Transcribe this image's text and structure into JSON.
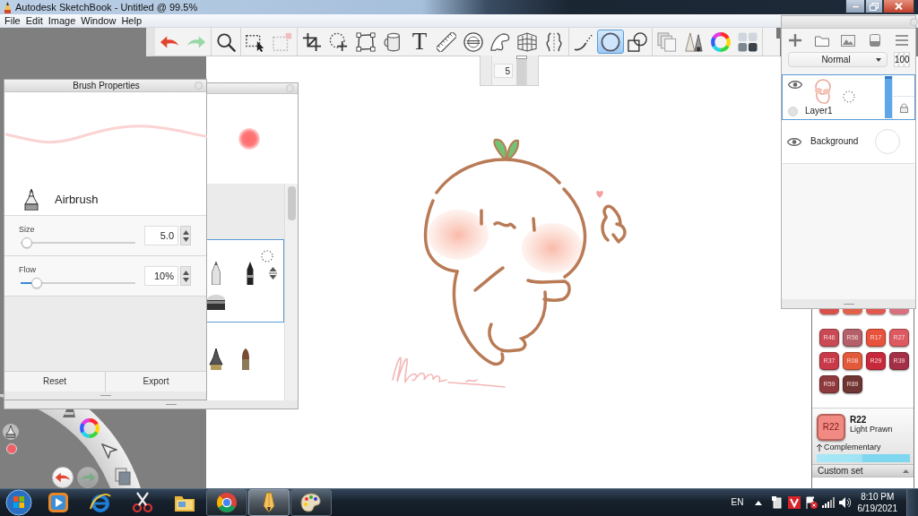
{
  "window": {
    "title": "Autodesk SketchBook - Untitled @ 99.5%"
  },
  "menu": [
    {
      "label": "File"
    },
    {
      "label": "Edit"
    },
    {
      "label": "Image"
    },
    {
      "label": "Window"
    },
    {
      "label": "Help"
    }
  ],
  "toolbar": {
    "groups": [
      [
        {
          "kind": "undo",
          "selected": false,
          "disabled": false
        },
        {
          "kind": "redo",
          "selected": false,
          "disabled": true
        }
      ],
      [
        {
          "kind": "zoom",
          "selected": false,
          "disabled": false
        }
      ],
      [
        {
          "kind": "select",
          "selected": false,
          "disabled": false
        },
        {
          "kind": "crop_selection",
          "selected": false,
          "disabled": true
        }
      ],
      [
        {
          "kind": "crop",
          "selected": false,
          "disabled": false
        },
        {
          "kind": "transform",
          "selected": false,
          "disabled": false
        },
        {
          "kind": "distort",
          "selected": false,
          "disabled": false
        },
        {
          "kind": "fill",
          "selected": false,
          "disabled": false
        },
        {
          "kind": "text",
          "glyph": "T",
          "selected": false,
          "disabled": false
        },
        {
          "kind": "ruler",
          "selected": false,
          "disabled": false
        },
        {
          "kind": "ellipse_guide",
          "selected": false,
          "disabled": false
        },
        {
          "kind": "french_curve",
          "selected": false,
          "disabled": false
        },
        {
          "kind": "perspective",
          "selected": false,
          "disabled": false
        },
        {
          "kind": "symmetry",
          "selected": false,
          "disabled": false
        }
      ],
      [
        {
          "kind": "stroke",
          "selected": false,
          "disabled": false
        },
        {
          "kind": "ellipse",
          "selected": true,
          "disabled": false
        },
        {
          "kind": "shapes",
          "selected": false,
          "disabled": false
        }
      ],
      [
        {
          "kind": "copic",
          "selected": false,
          "disabled": false
        },
        {
          "kind": "brushes",
          "selected": false,
          "disabled": false
        },
        {
          "kind": "color_wheel",
          "selected": false,
          "disabled": false
        },
        {
          "kind": "swatches",
          "selected": false,
          "disabled": false
        }
      ]
    ]
  },
  "brush_size_popup": {
    "value": "5",
    "level": 1
  },
  "brush_properties": {
    "title": "Brush Properties",
    "brush": "Airbrush",
    "sliders": [
      {
        "label": "Size",
        "value": "5.0",
        "level": 0.01
      },
      {
        "label": "Flow",
        "value": "10%",
        "level": 0.1
      }
    ],
    "buttons": [
      {
        "label": "Reset"
      },
      {
        "label": "Export"
      }
    ]
  },
  "brush_library": {
    "sets": [
      {
        "selected": true
      },
      {
        "selected": false
      }
    ]
  },
  "lagoon": [
    {
      "kind": "undo",
      "disabled": false
    },
    {
      "kind": "redo",
      "disabled": true
    }
  ],
  "layers": {
    "blend_mode": "Normal",
    "opacity": "100",
    "items": [
      {
        "kind": "layer",
        "name": "Layer1",
        "selected": true,
        "visible": true,
        "level": 1
      },
      {
        "kind": "background",
        "name": "Background",
        "selected": false,
        "visible": true
      }
    ]
  },
  "copic": {
    "swatches": [
      {
        "color": "#d8504a"
      },
      {
        "color": "#e0604a"
      },
      {
        "color": "#e0584f"
      },
      {
        "color": "#d87080"
      },
      {
        "code": "R46",
        "color": "#c94a55"
      },
      {
        "code": "R56",
        "color": "#b4606a"
      },
      {
        "code": "R17",
        "color": "#e8533c"
      },
      {
        "code": "R27",
        "color": "#dd5a62"
      },
      {
        "code": "R37",
        "color": "#c83a4a"
      },
      {
        "code": "R08",
        "color": "#e25a3a"
      },
      {
        "code": "R29",
        "color": "#c8283c"
      },
      {
        "code": "R39",
        "color": "#a33046"
      },
      {
        "code": "R59",
        "color": "#8e3a3c"
      },
      {
        "code": "R89",
        "color": "#6e3532"
      }
    ],
    "current": {
      "swatch_code": "R22",
      "code": "R22",
      "name": "Light Prawn",
      "color": "#f28a84"
    },
    "complementary": "Complementary",
    "set": "Custom set"
  },
  "taskbar": {
    "apps": [
      {
        "kind": "media_player",
        "running": false,
        "selected": false
      },
      {
        "kind": "browser",
        "running": false,
        "selected": false
      },
      {
        "kind": "snipping",
        "running": false,
        "selected": false
      },
      {
        "kind": "explorer",
        "running": false,
        "selected": false
      },
      {
        "kind": "chrome",
        "running": true,
        "selected": false
      },
      {
        "kind": "sketchbook",
        "running": true,
        "selected": true
      },
      {
        "kind": "paint",
        "running": true,
        "selected": false
      }
    ],
    "language": "EN",
    "time": "8:10 PM",
    "date": "6/19/2021"
  }
}
